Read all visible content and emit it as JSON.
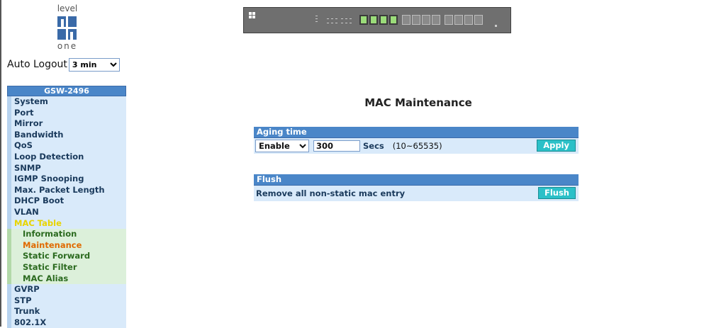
{
  "logo": {
    "top_text": "level",
    "bottom_text": "one"
  },
  "auto_logout": {
    "label": "Auto Logout",
    "selected": "3 min"
  },
  "menu": {
    "title": "GSW-2496",
    "items": [
      {
        "label": "System"
      },
      {
        "label": "Port"
      },
      {
        "label": "Mirror"
      },
      {
        "label": "Bandwidth"
      },
      {
        "label": "QoS"
      },
      {
        "label": "Loop Detection"
      },
      {
        "label": "SNMP"
      },
      {
        "label": "IGMP Snooping"
      },
      {
        "label": "Max. Packet Length"
      },
      {
        "label": "DHCP Boot"
      },
      {
        "label": "VLAN"
      },
      {
        "label": "MAC Table"
      }
    ],
    "mac_sub": [
      {
        "label": "Information"
      },
      {
        "label": "Maintenance"
      },
      {
        "label": "Static Forward"
      },
      {
        "label": "Static Filter"
      },
      {
        "label": "MAC Alias"
      }
    ],
    "items_after": [
      {
        "label": "GVRP"
      },
      {
        "label": "STP"
      },
      {
        "label": "Trunk"
      },
      {
        "label": "802.1X"
      }
    ]
  },
  "page": {
    "title": "MAC Maintenance"
  },
  "aging": {
    "header": "Aging time",
    "mode": "Enable",
    "value": "300",
    "unit": "Secs",
    "range": "(10~65535)",
    "apply_label": "Apply"
  },
  "flush": {
    "header": "Flush",
    "text": "Remove all non-static mac entry",
    "button_label": "Flush"
  }
}
